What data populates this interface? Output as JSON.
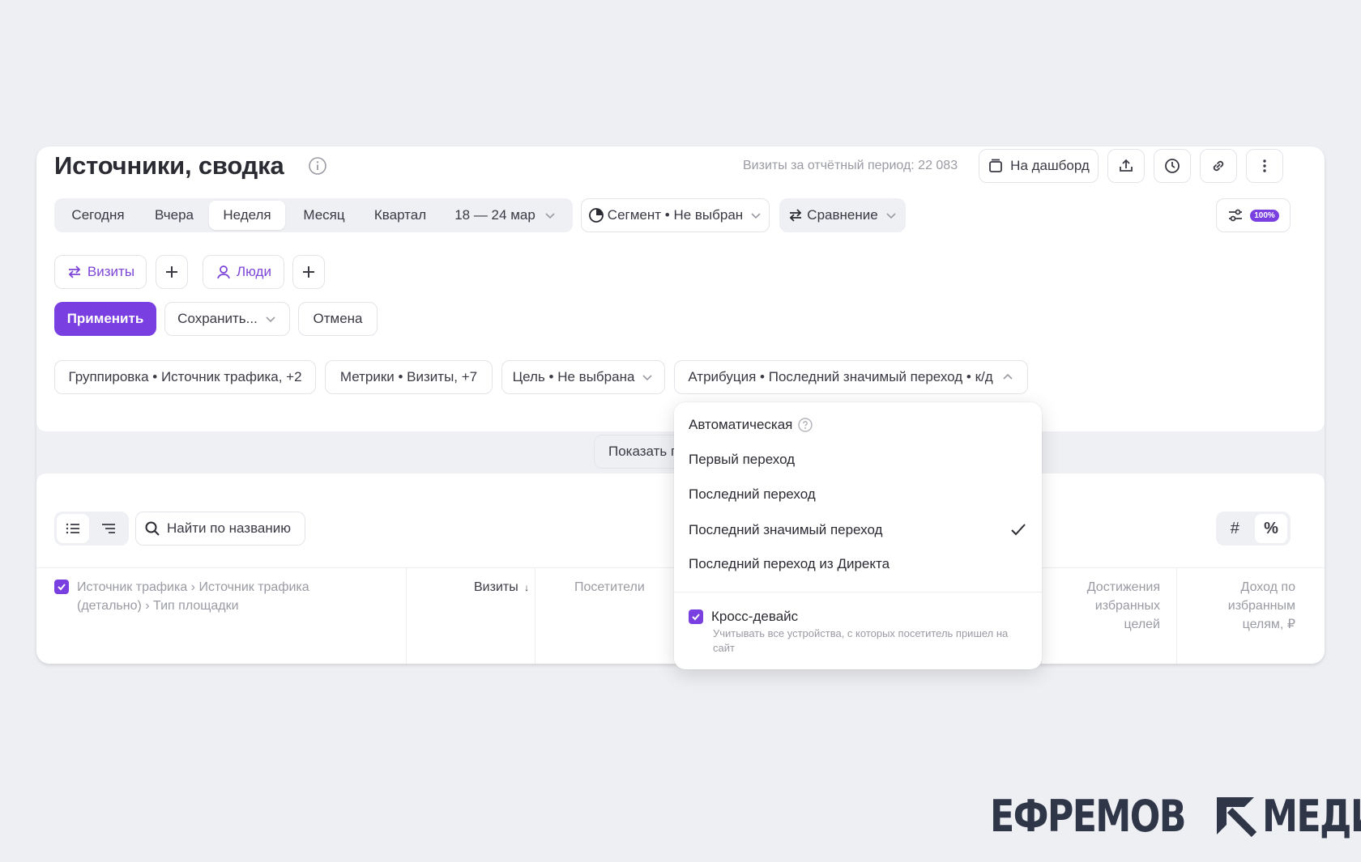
{
  "header": {
    "title": "Источники, сводка",
    "visits_info": "Визиты за отчётный период: 22 083",
    "dashboard_label": "На дашборд"
  },
  "periods": {
    "items": [
      "Сегодня",
      "Вчера",
      "Неделя",
      "Месяц",
      "Квартал"
    ],
    "active": "Неделя",
    "date_range": "18 — 24 мар"
  },
  "segment_label": "Сегмент • Не выбран",
  "comparison_label": "Сравнение",
  "sampling_badge": "100%",
  "segment_tags": {
    "visits": "Визиты",
    "people": "Люди"
  },
  "actions": {
    "apply": "Применить",
    "save": "Сохранить...",
    "cancel": "Отмена"
  },
  "filters": {
    "grouping": "Группировка • Источник трафика, +2",
    "metrics": "Метрики • Визиты, +7",
    "goal": "Цель • Не выбрана",
    "attribution": "Атрибуция • Последний значимый переход • к/д"
  },
  "show_button": "Показать г",
  "search": {
    "placeholder": "Найти по названию"
  },
  "format": {
    "absolute": "#",
    "percent": "%"
  },
  "table": {
    "group_header_line1": "Источник трафика › Источник трафика",
    "group_header_line2": "(детально) › Тип площадки",
    "col_visits": "Визиты",
    "col_visitors": "Посетители",
    "col_goals": [
      "Достижения",
      "избранных",
      "целей"
    ],
    "col_revenue": [
      "Доход по",
      "избранным",
      "целям, ₽"
    ]
  },
  "attribution_menu": {
    "items": [
      "Автоматическая",
      "Первый переход",
      "Последний переход",
      "Последний значимый переход",
      "Последний переход из Директа"
    ],
    "selected": "Последний значимый переход",
    "cross_device_label": "Кросс-девайс",
    "cross_device_hint": "Учитывать все устройства, с которых посетитель пришел на сайт",
    "cross_device_checked": true
  },
  "watermark": {
    "left": "ЕФРЕМОВ",
    "right": "МЕДИА"
  },
  "colors": {
    "accent": "#7a3fe0",
    "background": "#eeeff3",
    "logo": "#2f3648"
  }
}
